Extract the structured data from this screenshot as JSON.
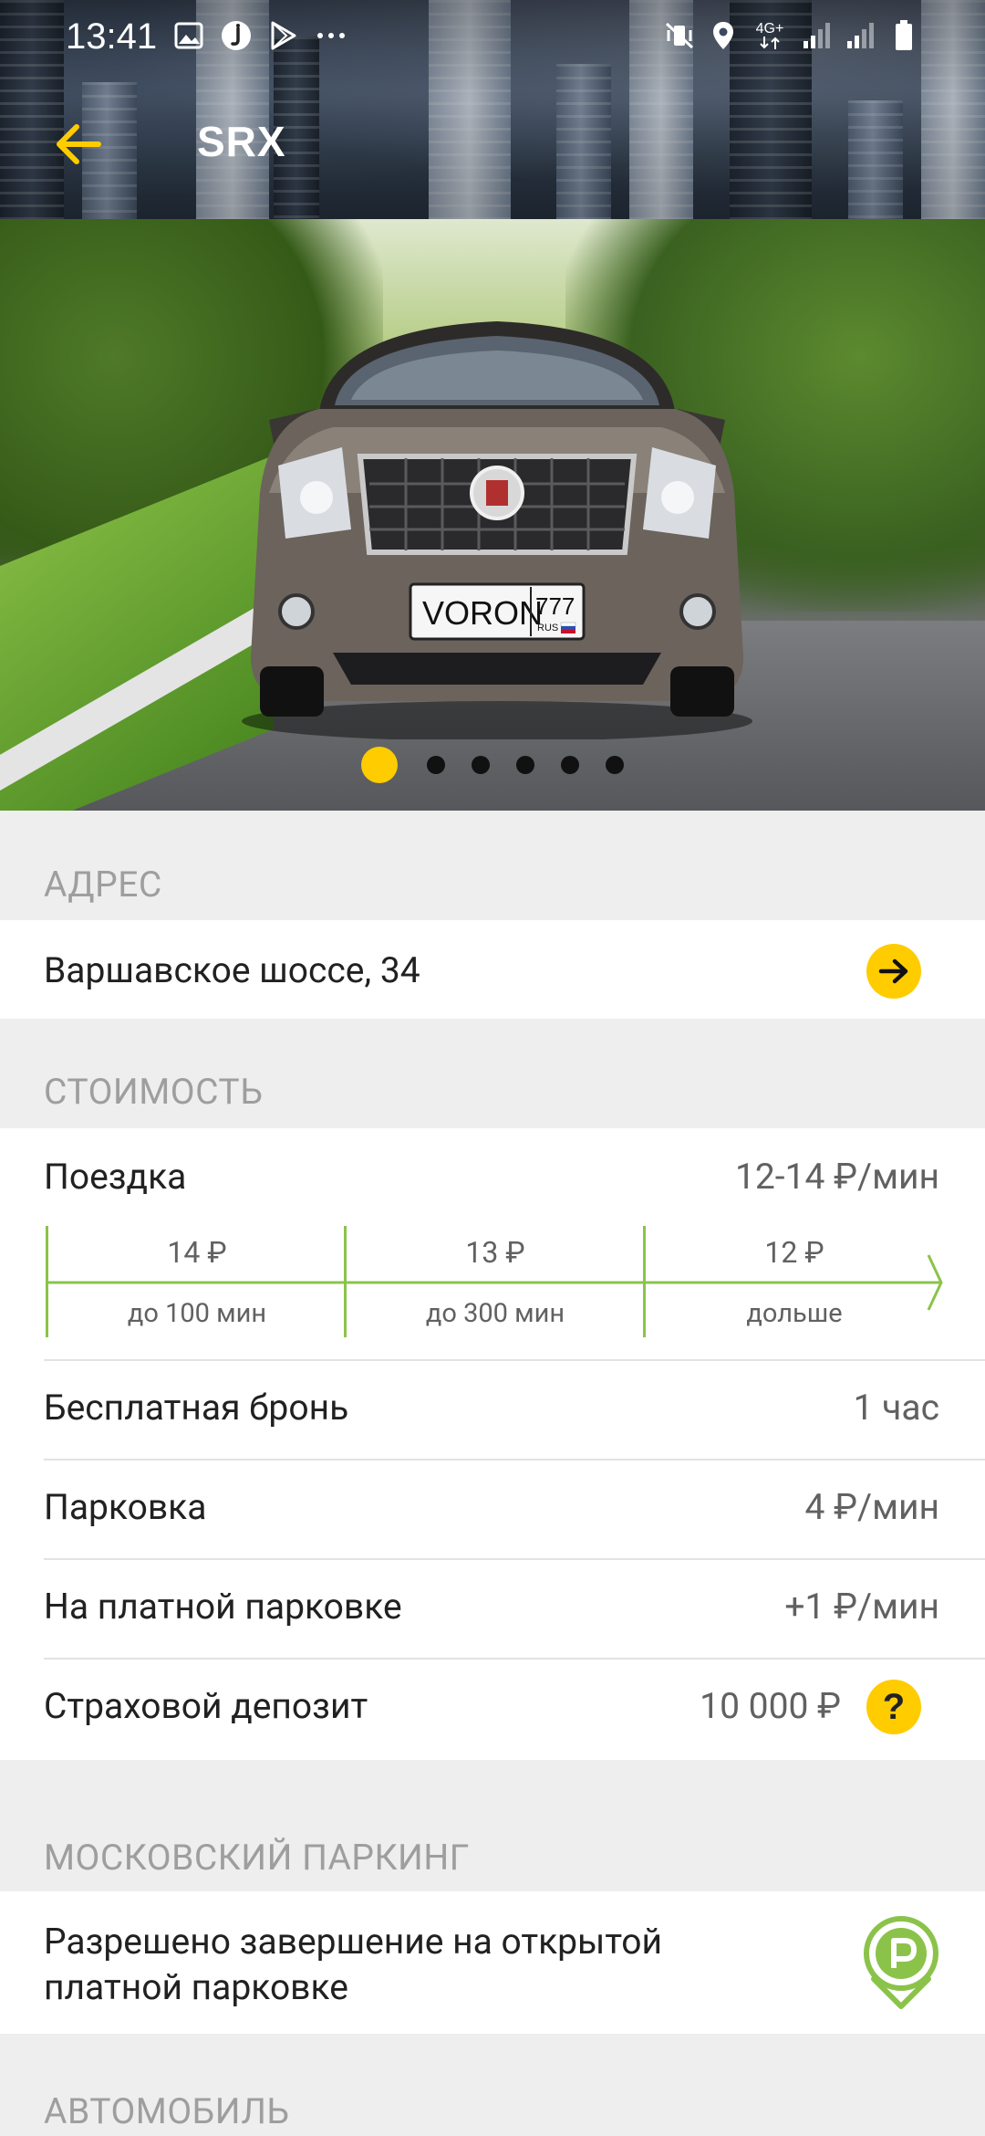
{
  "status_bar": {
    "time": "13:41",
    "network_label": "4G+",
    "left_icons": [
      "image-icon",
      "app-notification-icon",
      "play-store-icon",
      "more-dots-icon"
    ],
    "right_icons": [
      "mute-vibrate-icon",
      "location-icon",
      "network-4g-icon",
      "signal-icon",
      "signal-icon",
      "battery-icon"
    ]
  },
  "app_bar": {
    "title": "SRX",
    "back_icon": "arrow-left-icon",
    "accent_color": "#FFCC00"
  },
  "carousel": {
    "plate_text": "VORON",
    "plate_number": "777",
    "plate_region": "RUS",
    "slide_count": 6,
    "active_index": 0
  },
  "address": {
    "section_title": "АДРЕС",
    "value": "Варшавское шоссе, 34",
    "action_icon": "arrow-right-icon"
  },
  "cost": {
    "section_title": "СТОИМОСТЬ",
    "trip": {
      "label": "Поездка",
      "value": "12-14 ₽/мин"
    },
    "tiers": [
      {
        "price": "14 ₽",
        "duration": "до 100 мин"
      },
      {
        "price": "13 ₽",
        "duration": "до 300 мин"
      },
      {
        "price": "12 ₽",
        "duration": "дольше"
      }
    ],
    "rows": [
      {
        "label": "Бесплатная бронь",
        "value": "1 час"
      },
      {
        "label": "Парковка",
        "value": "4 ₽/мин"
      },
      {
        "label": "На платной парковке",
        "value": "+1 ₽/мин"
      },
      {
        "label": "Страховой депозит",
        "value": "10 000 ₽"
      }
    ],
    "deposit_help": "?"
  },
  "moscow_parking": {
    "section_title": "МОСКОВСКИЙ ПАРКИНГ",
    "text_line1": "Разрешено завершение на открытой",
    "text_line2": "платной парковке",
    "icon": "parking-pin-icon",
    "icon_color": "#8BC34A"
  },
  "car_section": {
    "section_title": "АВТОМОБИЛЬ"
  }
}
